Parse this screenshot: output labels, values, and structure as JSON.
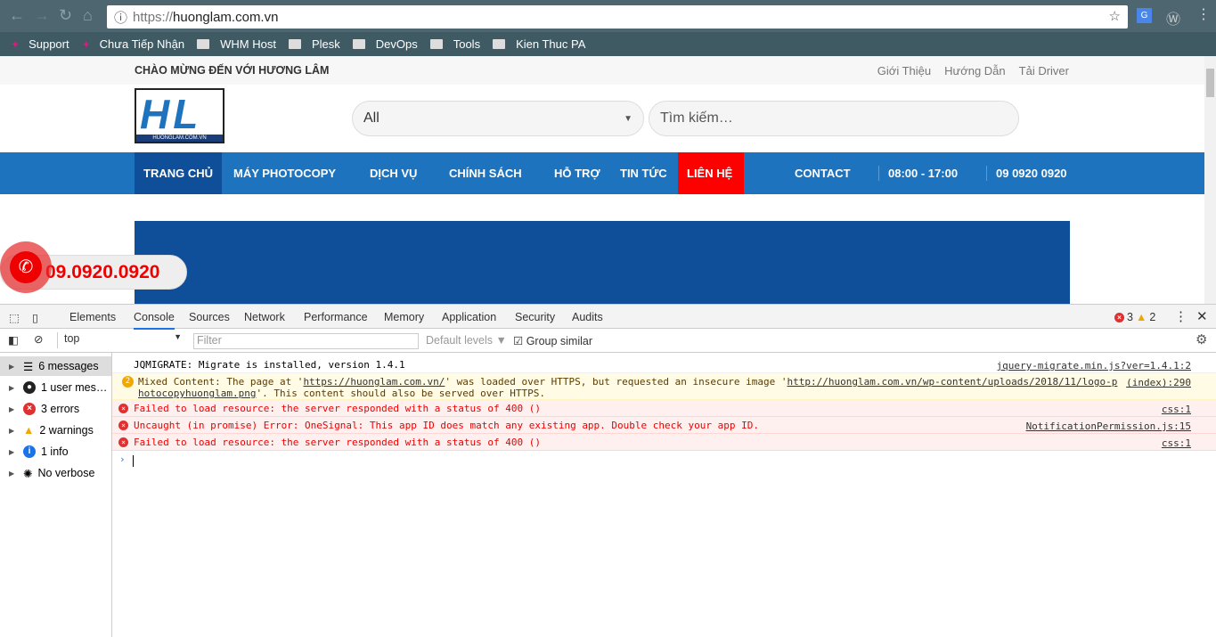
{
  "browser": {
    "url_scheme": "https://",
    "url_host": "huonglam.com.vn",
    "bookmarks": [
      {
        "label": "Support",
        "icon": "support-icon"
      },
      {
        "label": "Chưa Tiếp Nhận",
        "icon": "support-icon"
      },
      {
        "label": "WHM Host",
        "icon": "folder-icon"
      },
      {
        "label": "Plesk",
        "icon": "folder-icon"
      },
      {
        "label": "DevOps",
        "icon": "folder-icon"
      },
      {
        "label": "Tools",
        "icon": "folder-icon"
      },
      {
        "label": "Kien Thuc PA",
        "icon": "folder-icon"
      }
    ]
  },
  "site": {
    "welcome": "CHÀO MỪNG ĐẾN VỚI HƯƠNG LÂM",
    "top_links": [
      "Giới Thiệu",
      "Hướng Dẫn",
      "Tải Driver"
    ],
    "logo_text": "HL",
    "logo_caption": "HUONGLAM.COM.VN",
    "category_select": "All",
    "search_placeholder": "Tìm kiếm…",
    "menu": [
      "TRANG CHỦ",
      "MÁY PHOTOCOPY",
      "DỊCH VỤ",
      "CHÍNH SÁCH",
      "HỖ TRỢ",
      "TIN TỨC",
      "LIÊN HỆ",
      "CONTACT",
      "08:00 - 17:00",
      "09 0920 0920"
    ],
    "hotline": "09.0920.0920",
    "colors": {
      "menu": "#1e73be",
      "active": "#0f4f9a",
      "highlight": "#ff0000"
    }
  },
  "devtools": {
    "tabs": [
      "Elements",
      "Console",
      "Sources",
      "Network",
      "Performance",
      "Memory",
      "Application",
      "Security",
      "Audits"
    ],
    "active_tab": "Console",
    "error_count": "3",
    "warning_count": "2",
    "context": "top",
    "filter_placeholder": "Filter",
    "levels": "Default levels",
    "group_similar": "Group similar",
    "sidebar": [
      {
        "label": "6 messages",
        "icon": "list-icon"
      },
      {
        "label": "1 user mes…",
        "icon": "user-icon"
      },
      {
        "label": "3 errors",
        "icon": "error-icon"
      },
      {
        "label": "2 warnings",
        "icon": "warning-icon"
      },
      {
        "label": "1 info",
        "icon": "info-icon"
      },
      {
        "label": "No verbose",
        "icon": "bug-icon"
      }
    ],
    "messages": [
      {
        "type": "log",
        "text": "JQMIGRATE: Migrate is installed, version 1.4.1",
        "source": "jquery-migrate.min.js?ver=1.4.1:2"
      },
      {
        "type": "warning",
        "count": "2",
        "text1": "Mixed Content: The page at '",
        "link1": "https://huonglam.com.vn/",
        "text2": "' was loaded over HTTPS, but requested an insecure image '",
        "link2": "http://huonglam.com.vn/wp-content/uploads/2018/11/logo-p",
        "link2b": "hotocopyhuonglam.png",
        "text3": "'. This content should also be served over HTTPS.",
        "source": "(index):290"
      },
      {
        "type": "error",
        "text": "Failed to load resource: the server responded with a status of 400 ()",
        "source": "css:1"
      },
      {
        "type": "error",
        "text": "Uncaught (in promise) Error: OneSignal: This app ID does match any existing app. Double check your app ID.",
        "source": "NotificationPermission.js:15"
      },
      {
        "type": "error",
        "text": "Failed to load resource: the server responded with a status of 400 ()",
        "source": "css:1"
      }
    ]
  }
}
